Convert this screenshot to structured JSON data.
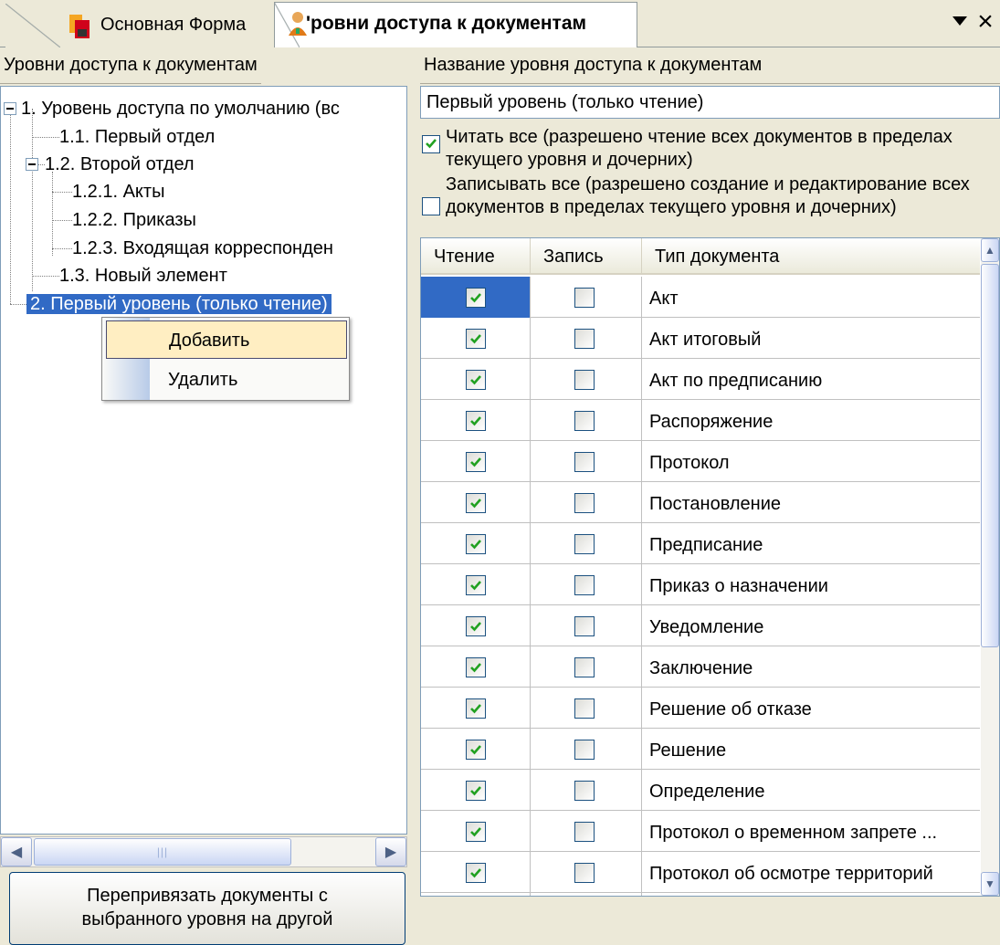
{
  "tabs": [
    {
      "label": "Основная Форма",
      "icon": "app-form-icon"
    },
    {
      "label": "'ровни доступа к документам",
      "icon": "user-icon"
    }
  ],
  "left_panel": {
    "header": "Уровни доступа к документам",
    "tree": [
      {
        "label": "1. Уровень доступа по умолчанию (вс",
        "depth": 0,
        "expanded": true
      },
      {
        "label": "1.1. Первый отдел",
        "depth": 1
      },
      {
        "label": "1.2. Второй отдел",
        "depth": 1,
        "expanded": true
      },
      {
        "label": "1.2.1. Акты",
        "depth": 2
      },
      {
        "label": "1.2.2. Приказы",
        "depth": 2
      },
      {
        "label": "1.2.3. Входящая корреспонден",
        "depth": 2
      },
      {
        "label": "1.3. Новый элемент",
        "depth": 1
      },
      {
        "label": "2. Первый уровень (только чтение)",
        "depth": 0,
        "selected": true
      }
    ],
    "relink_button_line1": "Перепривязать документы с",
    "relink_button_line2": "выбранного уровня на другой"
  },
  "context_menu": {
    "items": [
      "Добавить",
      "Удалить"
    ],
    "highlighted": "Добавить"
  },
  "right_panel": {
    "name_header": "Название уровня доступа к документам",
    "name_value": "Первый уровень (только чтение)",
    "read_all": {
      "checked": true,
      "label": "Читать все (разрешено чтение всех документов в пределах текущего уровня и дочерних)"
    },
    "write_all": {
      "checked": false,
      "label": "Записывать все (разрешено создание и редактирование всех документов в пределах текущего уровня и дочерних)"
    },
    "grid": {
      "columns": [
        "Чтение",
        "Запись",
        "Тип документа"
      ],
      "rows": [
        {
          "read": true,
          "write": false,
          "type": "Акт"
        },
        {
          "read": true,
          "write": false,
          "type": "Акт итоговый"
        },
        {
          "read": true,
          "write": false,
          "type": "Акт по предписанию"
        },
        {
          "read": true,
          "write": false,
          "type": "Распоряжение"
        },
        {
          "read": true,
          "write": false,
          "type": "Протокол"
        },
        {
          "read": true,
          "write": false,
          "type": "Постановление"
        },
        {
          "read": true,
          "write": false,
          "type": "Предписание"
        },
        {
          "read": true,
          "write": false,
          "type": "Приказ о назначении"
        },
        {
          "read": true,
          "write": false,
          "type": "Уведомление"
        },
        {
          "read": true,
          "write": false,
          "type": "Заключение"
        },
        {
          "read": true,
          "write": false,
          "type": "Решение об отказе"
        },
        {
          "read": true,
          "write": false,
          "type": "Решение"
        },
        {
          "read": true,
          "write": false,
          "type": "Определение"
        },
        {
          "read": true,
          "write": false,
          "type": "Протокол о временном запрете ..."
        },
        {
          "read": true,
          "write": false,
          "type": "Протокол об осмотре территорий"
        },
        {
          "read": false,
          "write": false,
          "type": ""
        }
      ]
    }
  },
  "colors": {
    "selection": "#316ac5",
    "check_green": "#21a121",
    "window_bg": "#ece9d8",
    "menu_highlight": "#ffeec2"
  }
}
